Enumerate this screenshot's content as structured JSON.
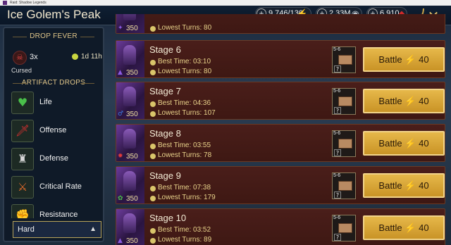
{
  "window": {
    "title": "Raid: Shadow Legends"
  },
  "header": {
    "title": "Ice Golem's Peak",
    "resources": [
      {
        "value": "9,746/130",
        "icon": "energy-bolt-icon",
        "color": "#e8e020"
      },
      {
        "value": "2.33M",
        "icon": "silver-coins-icon",
        "color": "#c0c8d0"
      },
      {
        "value": "6,910",
        "icon": "gem-icon",
        "color": "#d62a2a"
      }
    ],
    "close_icon": "close-icon"
  },
  "sidebar": {
    "drop_fever_title": "DROP FEVER",
    "fever_count": "3x",
    "fever_status": "Cursed",
    "fever_timer": "1d 11h",
    "artifact_drops_title": "ARTIFACT DROPS",
    "artifacts": [
      {
        "label": "Life",
        "icon": "heart-icon",
        "color": "#4ac04a"
      },
      {
        "label": "Offense",
        "icon": "sword-icon",
        "color": "#d83030"
      },
      {
        "label": "Defense",
        "icon": "tower-icon",
        "color": "#d8d8d8"
      },
      {
        "label": "Critical Rate",
        "icon": "crossed-swords-icon",
        "color": "#e06a2a"
      },
      {
        "label": "Resistance",
        "icon": "fist-icon",
        "color": "#c8b040"
      }
    ],
    "difficulty": "Hard"
  },
  "stages": [
    {
      "name": "",
      "best_time": "",
      "lowest_turns": "Lowest Turns: 80",
      "power": "350",
      "tier": "",
      "battle_label": "Battle",
      "energy": "40"
    },
    {
      "name": "Stage 6",
      "best_time": "Best Time: 03:10",
      "lowest_turns": "Lowest Turns: 80",
      "power": "350",
      "tier": "5-6",
      "battle_label": "Battle",
      "energy": "40"
    },
    {
      "name": "Stage 7",
      "best_time": "Best Time: 04:36",
      "lowest_turns": "Lowest Turns: 107",
      "power": "350",
      "tier": "5-6",
      "battle_label": "Battle",
      "energy": "40"
    },
    {
      "name": "Stage 8",
      "best_time": "Best Time: 03:55",
      "lowest_turns": "Lowest Turns: 78",
      "power": "350",
      "tier": "5-6",
      "battle_label": "Battle",
      "energy": "40"
    },
    {
      "name": "Stage 9",
      "best_time": "Best Time: 07:38",
      "lowest_turns": "Lowest Turns: 179",
      "power": "350",
      "tier": "5-6",
      "battle_label": "Battle",
      "energy": "40"
    },
    {
      "name": "Stage 10",
      "best_time": "Best Time: 03:52",
      "lowest_turns": "Lowest Turns: 89",
      "power": "350",
      "tier": "5-6",
      "battle_label": "Battle",
      "energy": "40"
    }
  ]
}
